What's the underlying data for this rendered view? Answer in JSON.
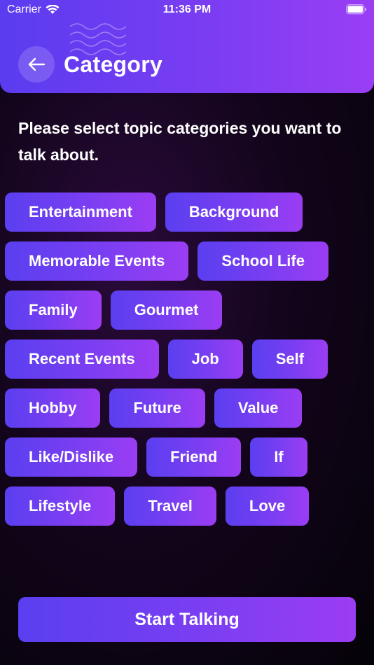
{
  "status_bar": {
    "carrier": "Carrier",
    "time": "11:36 PM"
  },
  "nav": {
    "title": "Category",
    "back_icon": "arrow-left-icon"
  },
  "prompt": "Please select topic categories you want to talk about.",
  "chip_rows": [
    [
      "Entertainment",
      "Background"
    ],
    [
      "Memorable Events",
      "School Life"
    ],
    [
      "Family",
      "Gourmet"
    ],
    [
      "Recent Events",
      "Job",
      "Self"
    ],
    [
      "Hobby",
      "Future",
      "Value"
    ],
    [
      "Like/Dislike",
      "Friend",
      "If"
    ],
    [
      "Lifestyle",
      "Travel",
      "Love"
    ]
  ],
  "start_button": "Start Talking",
  "colors": {
    "accent_start": "#5a3ff0",
    "accent_end": "#9b3df3",
    "background": "#0a030f"
  }
}
